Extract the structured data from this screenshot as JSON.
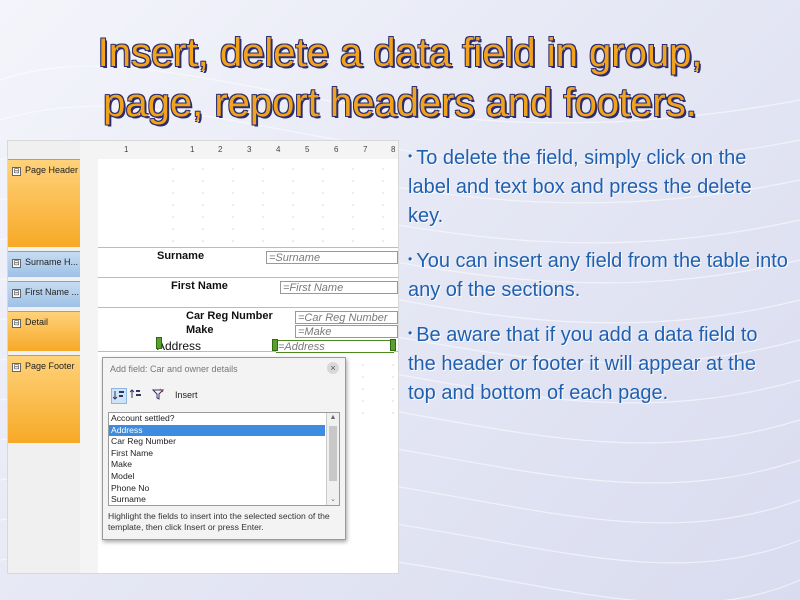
{
  "slide": {
    "title_line1": "Insert, delete a data field in group,",
    "title_line2": "page, report headers and footers.",
    "bullets": [
      "To delete the field, simply click on the label and text box and press the delete key.",
      "You can insert any field from the table into any of the sections.",
      "Be aware that if you add a data field to the header or footer it will appear at the top and bottom of each page."
    ],
    "bullet_symbol": "•"
  },
  "designer": {
    "ruler_marks": [
      "1",
      "1",
      "2",
      "3",
      "4",
      "5",
      "6",
      "7",
      "8"
    ],
    "sections": [
      {
        "label": "Page Header",
        "toggle": "⊟",
        "color": "orange"
      },
      {
        "label": "Surname H...",
        "toggle": "⊟",
        "color": "blue"
      },
      {
        "label": "First Name ...",
        "toggle": "⊟",
        "color": "blue"
      },
      {
        "label": "Detail",
        "toggle": "⊟",
        "color": "orange"
      },
      {
        "label": "Page Footer",
        "toggle": "⊟",
        "color": "orange"
      }
    ],
    "fields": {
      "surname_label": "Surname",
      "surname_box": "=Surname",
      "firstname_label": "First Name",
      "firstname_box": "=First Name",
      "carreg_label": "Car Reg Number",
      "carreg_box": "=Car Reg Number",
      "make_label": "Make",
      "make_box": "=Make",
      "address_label": "Address",
      "address_box": "=Address"
    }
  },
  "dialog": {
    "title": "Add field: Car and owner details",
    "close_symbol": "×",
    "insert_label": "Insert",
    "list_items": [
      "Account settled?",
      "Address",
      "Car Reg Number",
      "First Name",
      "Make",
      "Model",
      "Phone No",
      "Surname"
    ],
    "selected_item": "Address",
    "hint": "Highlight the fields to insert into the selected section of the template, then click Insert or press Enter."
  },
  "colors": {
    "title": "#f2a31d",
    "title_outline": "#2c2c6e",
    "bullet_text": "#1f5fb0",
    "section_orange": "#f7a927",
    "section_blue": "#9ec1e6",
    "list_selection": "#3c8de0"
  }
}
